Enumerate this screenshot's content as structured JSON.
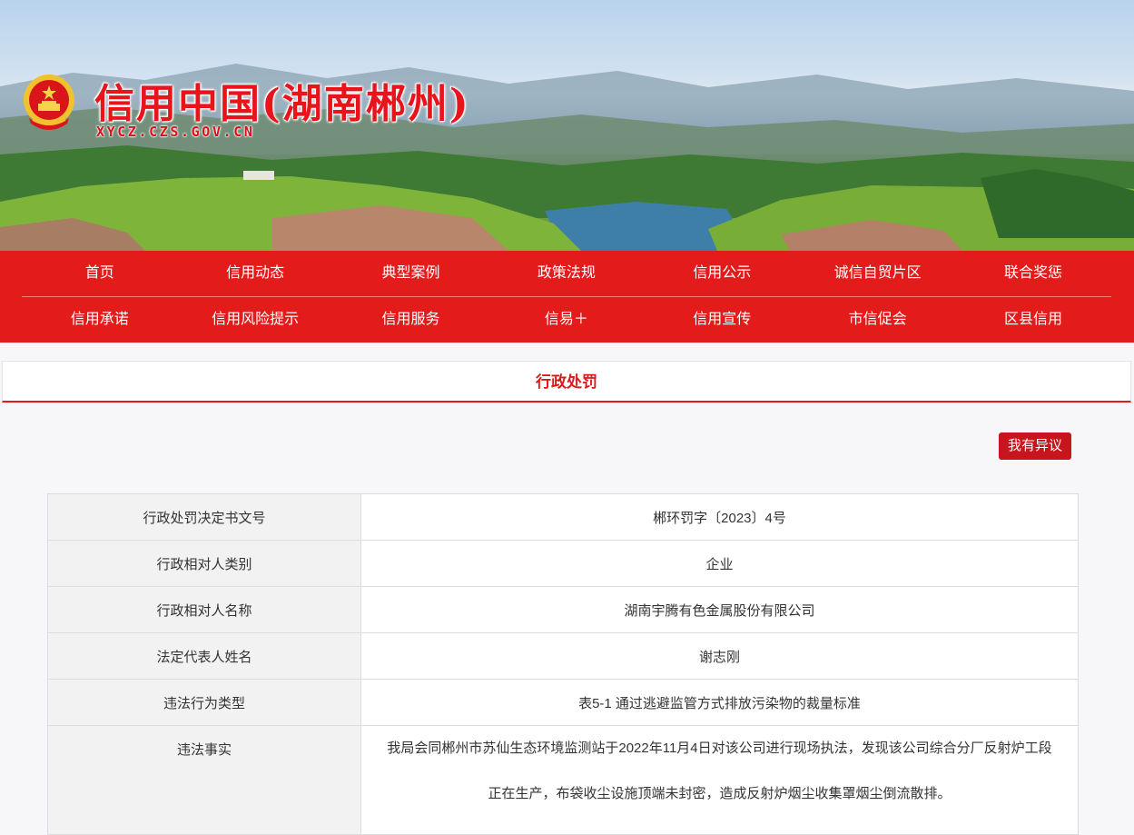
{
  "site": {
    "title": "信用中国(湖南郴州)",
    "url": "XYCZ.CZS.GOV.CN"
  },
  "nav": {
    "row1": [
      "首页",
      "信用动态",
      "典型案例",
      "政策法规",
      "信用公示",
      "诚信自贸片区",
      "联合奖惩"
    ],
    "row2": [
      "信用承诺",
      "信用风险提示",
      "信用服务",
      "信易＋",
      "信用宣传",
      "市信促会",
      "区县信用"
    ]
  },
  "section": {
    "title": "行政处罚"
  },
  "objection_button": "我有异议",
  "record": [
    {
      "label": "行政处罚决定书文号",
      "value": "郴环罚字〔2023〕4号"
    },
    {
      "label": "行政相对人类别",
      "value": "企业"
    },
    {
      "label": "行政相对人名称",
      "value": "湖南宇腾有色金属股份有限公司"
    },
    {
      "label": "法定代表人姓名",
      "value": "谢志刚"
    },
    {
      "label": "违法行为类型",
      "value": "表5-1 通过逃避监管方式排放污染物的裁量标准"
    },
    {
      "label": "违法事实",
      "value_lines": [
        "我局会同郴州市苏仙生态环境监测站于2022年11月4日对该公司进行现场执法，发现该公司综合分厂反射炉工段",
        "正在生产，布袋收尘设施顶端未封密，造成反射炉烟尘收集罩烟尘倒流散排。"
      ]
    }
  ],
  "colors": {
    "brand_red": "#e41b1b",
    "button_red": "#c8141c",
    "title_red": "#d81a1a"
  }
}
